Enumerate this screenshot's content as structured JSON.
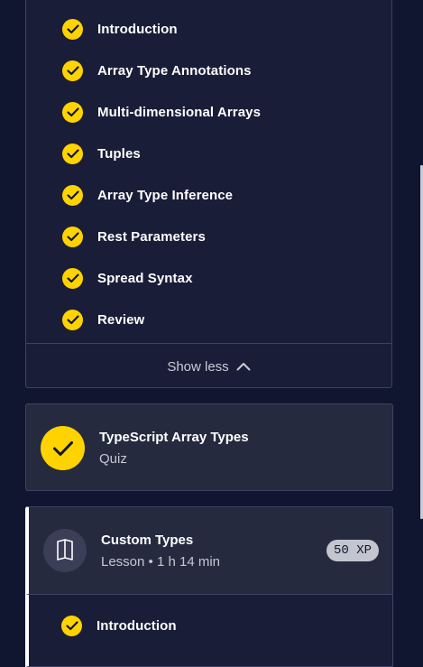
{
  "module_lessons": {
    "items": [
      {
        "label": "Introduction"
      },
      {
        "label": "Array Type Annotations"
      },
      {
        "label": "Multi-dimensional Arrays"
      },
      {
        "label": "Tuples"
      },
      {
        "label": "Array Type Inference"
      },
      {
        "label": "Rest Parameters"
      },
      {
        "label": "Spread Syntax"
      },
      {
        "label": "Review"
      }
    ],
    "show_less_label": "Show less"
  },
  "quiz_card": {
    "title": "TypeScript Array Types",
    "subtitle": "Quiz"
  },
  "custom_types_card": {
    "title": "Custom Types",
    "subtitle": "Lesson • 1 h 14 min",
    "xp_badge": "50 XP",
    "items": [
      {
        "label": "Introduction"
      }
    ]
  },
  "colors": {
    "background": "#10162f",
    "panel": "#1a1d38",
    "card": "#262a3f",
    "accent_yellow": "#ffd300",
    "border": "#3d4264"
  },
  "icons": {
    "completed": "checkmark-icon",
    "show_less": "chevron-up-icon",
    "lesson": "book-icon"
  }
}
